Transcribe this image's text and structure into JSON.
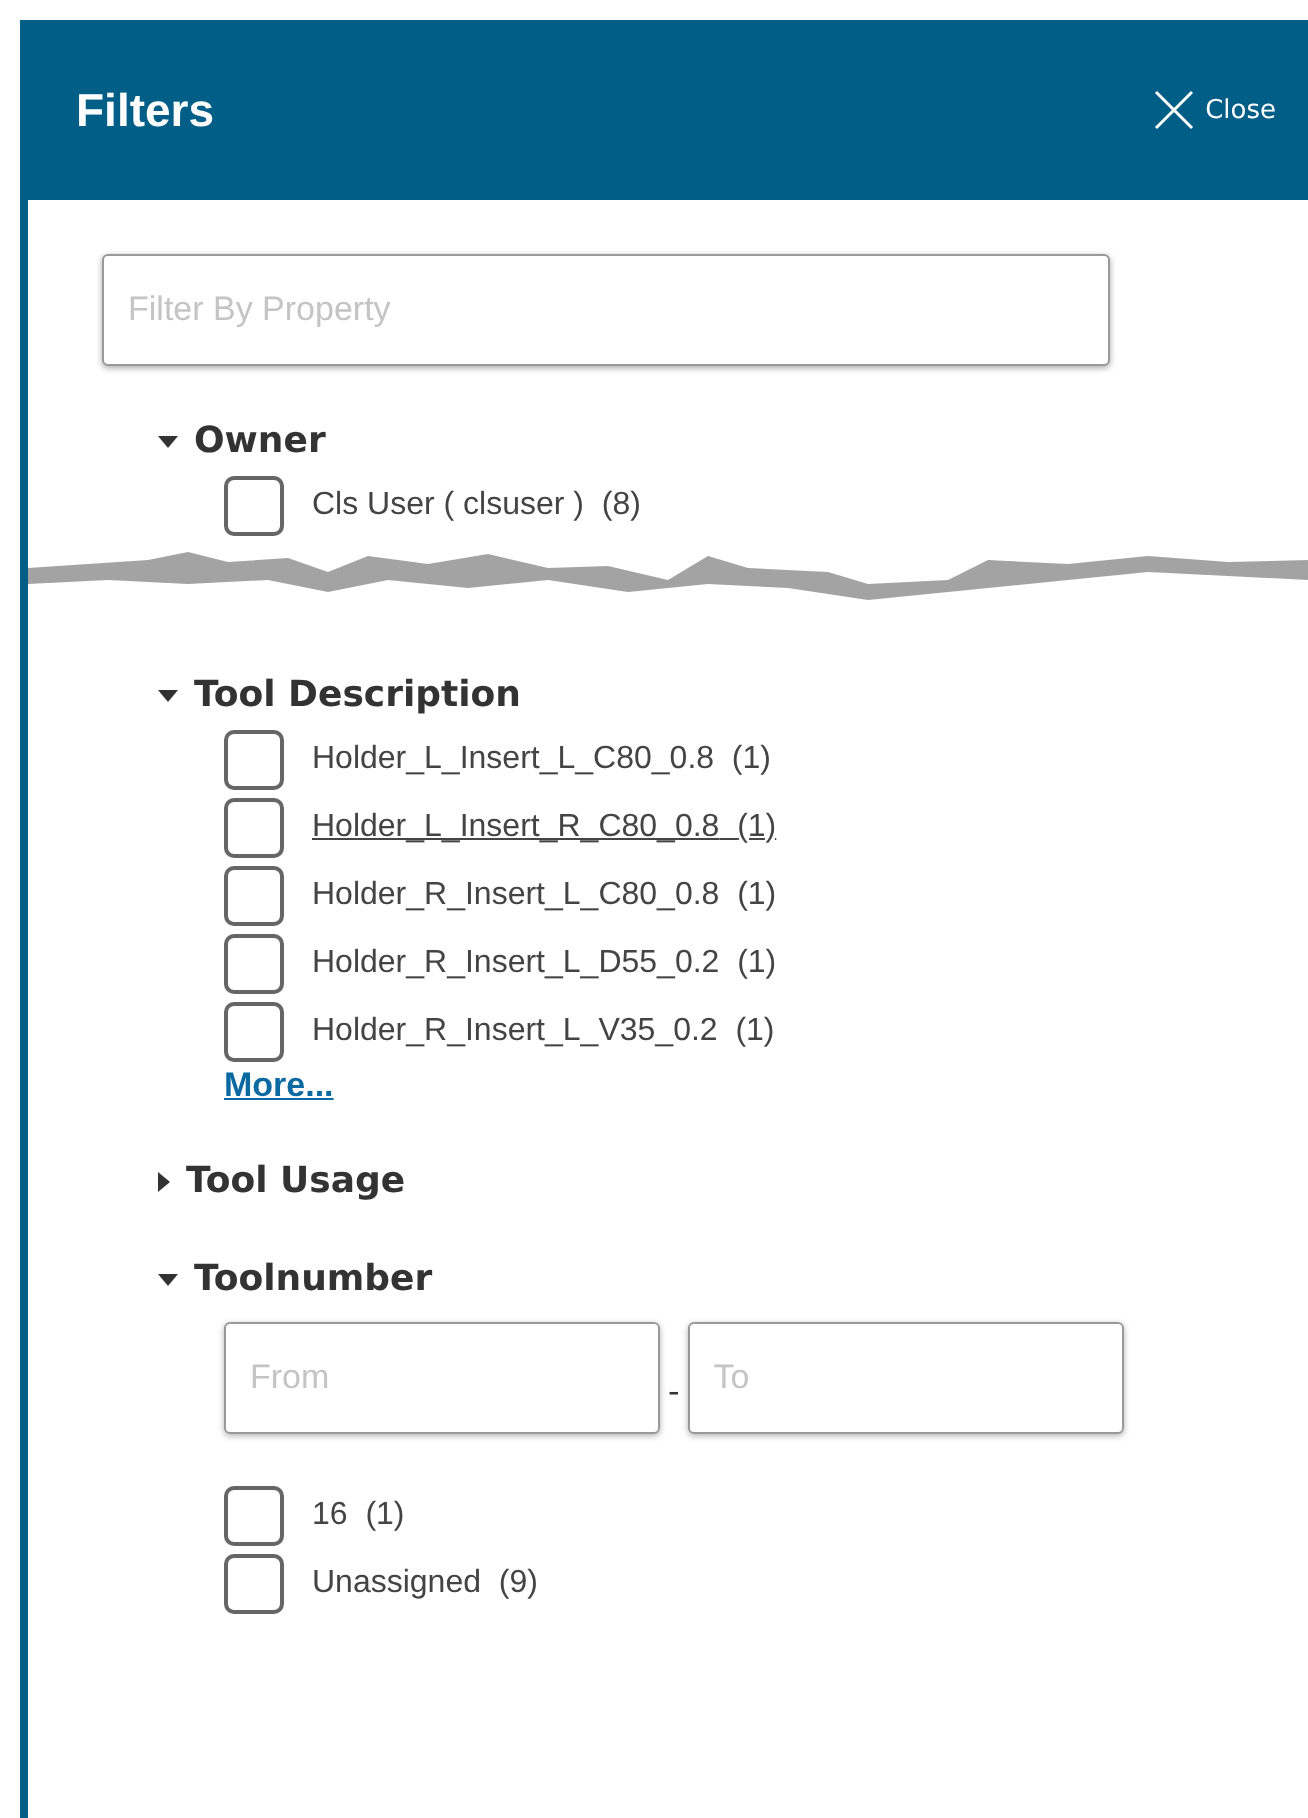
{
  "header": {
    "title": "Filters",
    "close_label": "Close"
  },
  "search": {
    "placeholder": "Filter By Property"
  },
  "sections": [
    {
      "kind": "checklist",
      "title": "Owner",
      "expanded": true,
      "torn": true,
      "items": [
        {
          "label": "Cls User ( clsuser )",
          "count": "(8)",
          "checked": false,
          "hovered": false
        }
      ]
    },
    {
      "kind": "checklist",
      "title": "Tool Description",
      "expanded": true,
      "more": "More...",
      "items": [
        {
          "label": "Holder_L_Insert_L_C80_0.8",
          "count": "(1)",
          "checked": false,
          "hovered": false
        },
        {
          "label": "Holder_L_Insert_R_C80_0.8",
          "count": "(1)",
          "checked": false,
          "hovered": true
        },
        {
          "label": "Holder_R_Insert_L_C80_0.8",
          "count": "(1)",
          "checked": false,
          "hovered": false
        },
        {
          "label": "Holder_R_Insert_L_D55_0.2",
          "count": "(1)",
          "checked": false,
          "hovered": false
        },
        {
          "label": "Holder_R_Insert_L_V35_0.2",
          "count": "(1)",
          "checked": false,
          "hovered": false
        }
      ]
    },
    {
      "title": "Tool Usage",
      "expanded": false
    },
    {
      "kind": "range",
      "title": "Toolnumber",
      "expanded": true,
      "from_placeholder": "From",
      "separator": "-",
      "to_placeholder": "To",
      "items": [
        {
          "label": "16",
          "count": "(1)",
          "checked": false,
          "hovered": false
        },
        {
          "label": "Unassigned",
          "count": "(9)",
          "checked": false,
          "hovered": false
        }
      ]
    }
  ]
}
